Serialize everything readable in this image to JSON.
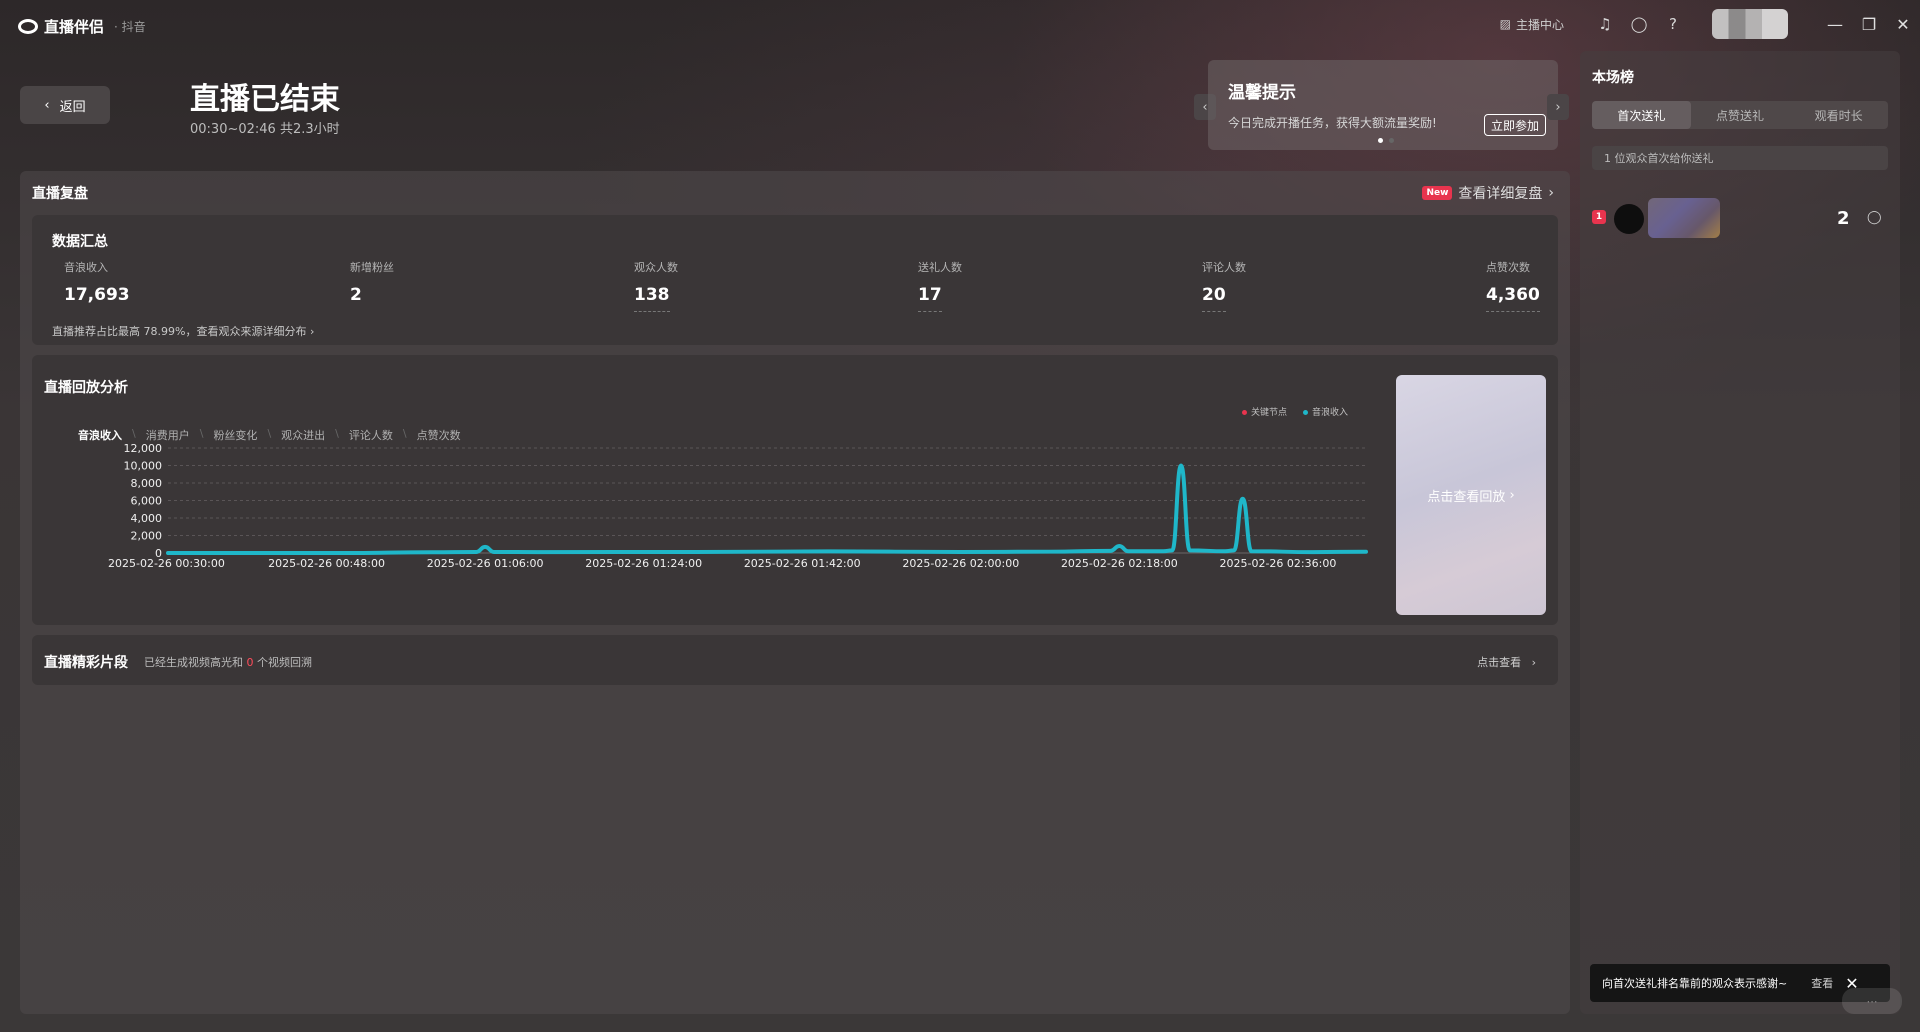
{
  "app": {
    "name": "直播伴侣",
    "sub": "· 抖音"
  },
  "titlebar": {
    "anchor_center": "主播中心",
    "icons": [
      "headset-icon",
      "message-icon",
      "help-icon"
    ]
  },
  "header": {
    "back_label": "返回",
    "title": "直播已结束",
    "subtitle": "00:30~02:46 共2.3小时"
  },
  "tip": {
    "title": "温馨提示",
    "text": "今日完成开播任务，获得大额流量奖励!",
    "button": "立即参加"
  },
  "review": {
    "title": "直播复盘",
    "new_badge": "New",
    "detail_link": "查看详细复盘",
    "summary": {
      "title": "数据汇总",
      "metrics": [
        {
          "label": "音浪收入",
          "value": "17,693"
        },
        {
          "label": "新增粉丝",
          "value": "2"
        },
        {
          "label": "观众人数",
          "value": "138"
        },
        {
          "label": "送礼人数",
          "value": "17"
        },
        {
          "label": "评论人数",
          "value": "20"
        },
        {
          "label": "点赞次数",
          "value": "4,360"
        }
      ],
      "note": "直播推荐占比最高 78.99%，查看观众来源详细分布"
    },
    "analysis": {
      "title": "直播回放分析",
      "tabs": [
        "音浪收入",
        "消费用户",
        "粉丝变化",
        "观众进出",
        "评论人数",
        "点赞次数"
      ],
      "active_tab": "音浪收入",
      "legend": [
        {
          "label": "关键节点",
          "color": "#e8344e"
        },
        {
          "label": "音浪收入",
          "color": "#1fb7c9"
        }
      ],
      "replay_label": "点击查看回放"
    },
    "highlights": {
      "title": "直播精彩片段",
      "text_before": "已经生成视频高光和",
      "count": "0",
      "text_after": "个视频回溯",
      "link": "点击查看"
    }
  },
  "side": {
    "title": "本场榜",
    "tabs": [
      "首次送礼",
      "点赞送礼",
      "观看时长"
    ],
    "active_tab": "首次送礼",
    "note": "1 位观众首次给你送礼",
    "ranks": [
      {
        "rank": "1",
        "value": "2"
      }
    ],
    "toast": "向首次送礼排名靠前的观众表示感谢~",
    "toast_view": "查看"
  },
  "chart_data": {
    "type": "line",
    "title": "",
    "xlabel": "",
    "ylabel": "",
    "ylim": [
      0,
      12000
    ],
    "yticks": [
      "12,000",
      "10,000",
      "8,000",
      "6,000",
      "4,000",
      "2,000",
      "0"
    ],
    "xticks": [
      "2025-02-26 00:30:00",
      "2025-02-26 00:48:00",
      "2025-02-26 01:06:00",
      "2025-02-26 01:24:00",
      "2025-02-26 01:42:00",
      "2025-02-26 02:00:00",
      "2025-02-26 02:18:00",
      "2025-02-26 02:36:00"
    ],
    "series": [
      {
        "name": "音浪收入",
        "color": "#1fb7c9",
        "x": [
          "00:30",
          "00:50",
          "01:00",
          "01:05",
          "01:06",
          "01:07",
          "01:12",
          "01:30",
          "01:45",
          "02:00",
          "02:10",
          "02:17",
          "02:18",
          "02:19",
          "02:23",
          "02:24",
          "02:25",
          "02:26",
          "02:30",
          "02:31",
          "02:32",
          "02:33",
          "02:40",
          "02:46"
        ],
        "y": [
          0,
          0,
          80,
          120,
          700,
          120,
          100,
          120,
          180,
          120,
          150,
          250,
          800,
          200,
          200,
          300,
          10000,
          300,
          200,
          300,
          6200,
          200,
          100,
          150
        ]
      }
    ]
  }
}
